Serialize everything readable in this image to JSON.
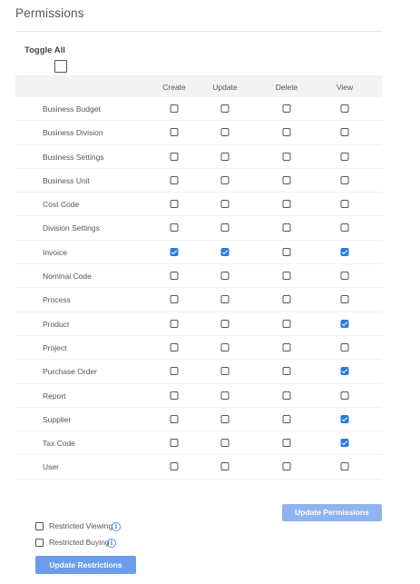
{
  "page": {
    "title": "Permissions"
  },
  "toggle_all": {
    "label": "Toggle All",
    "checked": false
  },
  "columns": [
    "Create",
    "Update",
    "Delete",
    "View"
  ],
  "rows": [
    {
      "label": "Business Budget",
      "values": [
        false,
        false,
        false,
        false
      ]
    },
    {
      "label": "Business Division",
      "values": [
        false,
        false,
        false,
        false
      ]
    },
    {
      "label": "Business Settings",
      "values": [
        false,
        false,
        false,
        false
      ]
    },
    {
      "label": "Business Unit",
      "values": [
        false,
        false,
        false,
        false
      ]
    },
    {
      "label": "Cost Code",
      "values": [
        false,
        false,
        false,
        false
      ]
    },
    {
      "label": "Division Settings",
      "values": [
        false,
        false,
        false,
        false
      ]
    },
    {
      "label": "Invoice",
      "values": [
        true,
        true,
        false,
        true
      ]
    },
    {
      "label": "Nominal Code",
      "values": [
        false,
        false,
        false,
        false
      ]
    },
    {
      "label": "Process",
      "values": [
        false,
        false,
        false,
        false
      ]
    },
    {
      "label": "Product",
      "values": [
        false,
        false,
        false,
        true
      ]
    },
    {
      "label": "Project",
      "values": [
        false,
        false,
        false,
        false
      ]
    },
    {
      "label": "Purchase Order",
      "values": [
        false,
        false,
        false,
        true
      ]
    },
    {
      "label": "Report",
      "values": [
        false,
        false,
        false,
        false
      ]
    },
    {
      "label": "Supplier",
      "values": [
        false,
        false,
        false,
        true
      ]
    },
    {
      "label": "Tax Code",
      "values": [
        false,
        false,
        false,
        true
      ]
    },
    {
      "label": "User",
      "values": [
        false,
        false,
        false,
        false
      ]
    }
  ],
  "buttons": {
    "update_permissions": "Update Permissions",
    "update_restrictions": "Update Restrictions"
  },
  "restrictions": [
    {
      "label": "Restricted Viewing",
      "checked": false,
      "icon": "info-icon"
    },
    {
      "label": "Restricted Buying",
      "checked": false,
      "icon": "info-icon"
    }
  ],
  "colors": {
    "accent": "#2b7ad9",
    "button": "#8fb3ef",
    "button_dark": "#6d9cea"
  }
}
